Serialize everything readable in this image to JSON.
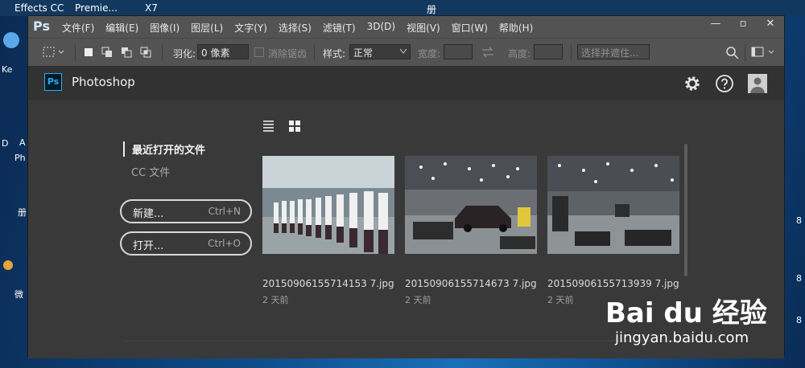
{
  "desktop": {
    "top_items": [
      "Effects CC",
      "Premie...",
      "X7",
      "册"
    ],
    "left_labels": [
      "Ke",
      "D",
      "A",
      "Ph",
      "册",
      "微"
    ],
    "right_labels": [
      "8",
      "8",
      "8"
    ]
  },
  "menubar": {
    "logo": "Ps",
    "items": [
      "文件(F)",
      "编辑(E)",
      "图像(I)",
      "图层(L)",
      "文字(Y)",
      "选择(S)",
      "滤镜(T)",
      "3D(D)",
      "视图(V)",
      "窗口(W)",
      "帮助(H)"
    ]
  },
  "window_controls": {
    "minimize": "—",
    "maximize": "▫",
    "close": "✕"
  },
  "options_bar": {
    "feather_label": "羽化:",
    "feather_value": "0 像素",
    "antialias_label": "消除锯齿",
    "style_label": "样式:",
    "style_value": "正常",
    "width_label": "宽度:",
    "height_label": "高度:",
    "select_mask": "选择并遮住..."
  },
  "workspace": {
    "badge": "Ps",
    "title": "Photoshop",
    "nav": {
      "recent": "最近打开的文件",
      "cc_files": "CC 文件"
    },
    "buttons": [
      {
        "label": "新建...",
        "shortcut": "Ctrl+N"
      },
      {
        "label": "打开...",
        "shortcut": "Ctrl+O"
      }
    ],
    "files": [
      {
        "name": "20150906155714153 7.jpg",
        "age": "2 天前"
      },
      {
        "name": "20150906155714673 7.jpg",
        "age": "2 天前"
      },
      {
        "name": "20150906155713939 7.jpg",
        "age": "2 天前"
      }
    ]
  },
  "watermark": {
    "brand": "Bai du 经验",
    "url": "jingyan.baidu.com"
  },
  "colors": {
    "accent": "#31a8ff",
    "panel": "#393939",
    "bar": "#535353"
  }
}
